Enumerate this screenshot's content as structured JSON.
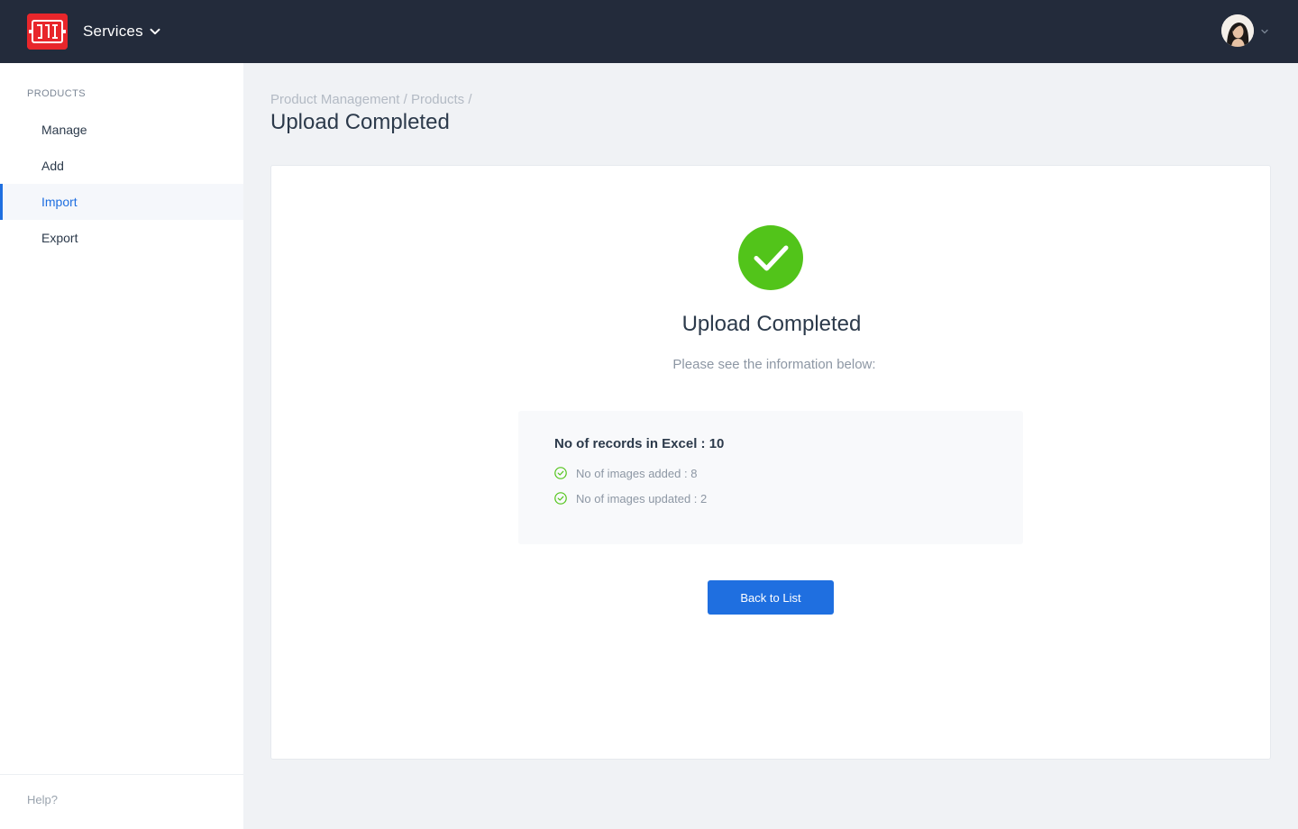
{
  "header": {
    "logo_icon": "brand-logo",
    "services_label": "Services",
    "services_icon": "chevron-down-icon",
    "avatar": "user-avatar",
    "avatar_menu_icon": "chevron-down-icon",
    "background": "#232b3b",
    "logo_color": "#e8262b"
  },
  "sidebar": {
    "section_title": "PRODUCTS",
    "items": [
      {
        "label": "Manage",
        "active": false
      },
      {
        "label": "Add",
        "active": false
      },
      {
        "label": "Import",
        "active": true
      },
      {
        "label": "Export",
        "active": false
      }
    ],
    "help_label": "Help?"
  },
  "breadcrumb": {
    "items": [
      "Product Management",
      "Products"
    ],
    "separator": "/"
  },
  "page": {
    "title": "Upload Completed"
  },
  "result": {
    "icon": "success-check-icon",
    "title": "Upload Completed",
    "subtitle": "Please see the information below:",
    "records_line": "No of records in Excel : 10",
    "stats": [
      {
        "icon": "check-circle-icon",
        "text": "No of images added : 8"
      },
      {
        "icon": "check-circle-icon",
        "text": "No of images updated : 2"
      }
    ],
    "success_color": "#52c41a"
  },
  "actions": {
    "back_label": "Back to List",
    "accent_color": "#1f6fe0"
  }
}
